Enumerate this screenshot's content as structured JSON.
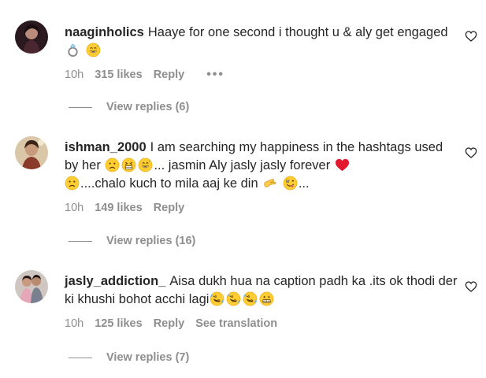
{
  "colors": {
    "text": "#262626",
    "secondary": "#8e8e8e",
    "heart_red": "#ed4956"
  },
  "comments": [
    {
      "username": "naaginholics",
      "text_parts": [
        "Haaye for one second i thought u & aly get engaged"
      ],
      "emojis": [
        "ring-emoji",
        "grinning-sweat-emoji"
      ],
      "time": "10h",
      "likes": "315 likes",
      "reply": "Reply",
      "more": "•••",
      "view_replies": "View replies (6)"
    },
    {
      "username": "ishman_2000",
      "text_parts": [
        "I am searching my happiness in the hashtags used by her",
        "... jasmin Aly jasly jasly forever",
        "....chalo kuch to mila aaj ke din",
        "..."
      ],
      "emojis": [
        "frowning-emoji",
        "confounded-emoji",
        "grinning-sweat-emoji",
        "red-heart-emoji",
        "frowning-emoji",
        "pinching-hand-emoji",
        "zany-face-emoji"
      ],
      "time": "10h",
      "likes": "149 likes",
      "reply": "Reply",
      "view_replies": "View replies (16)"
    },
    {
      "username": "jasly_addiction_",
      "text_parts": [
        "Aisa dukh hua na caption padh ka .its ok thodi der ki khushi bohot acchi lagi"
      ],
      "emojis": [
        "rofl-emoji",
        "rofl-emoji",
        "rofl-emoji",
        "grimacing-emoji"
      ],
      "time": "10h",
      "likes": "125 likes",
      "reply": "Reply",
      "see_translation": "See translation",
      "view_replies": "View replies (7)"
    }
  ]
}
